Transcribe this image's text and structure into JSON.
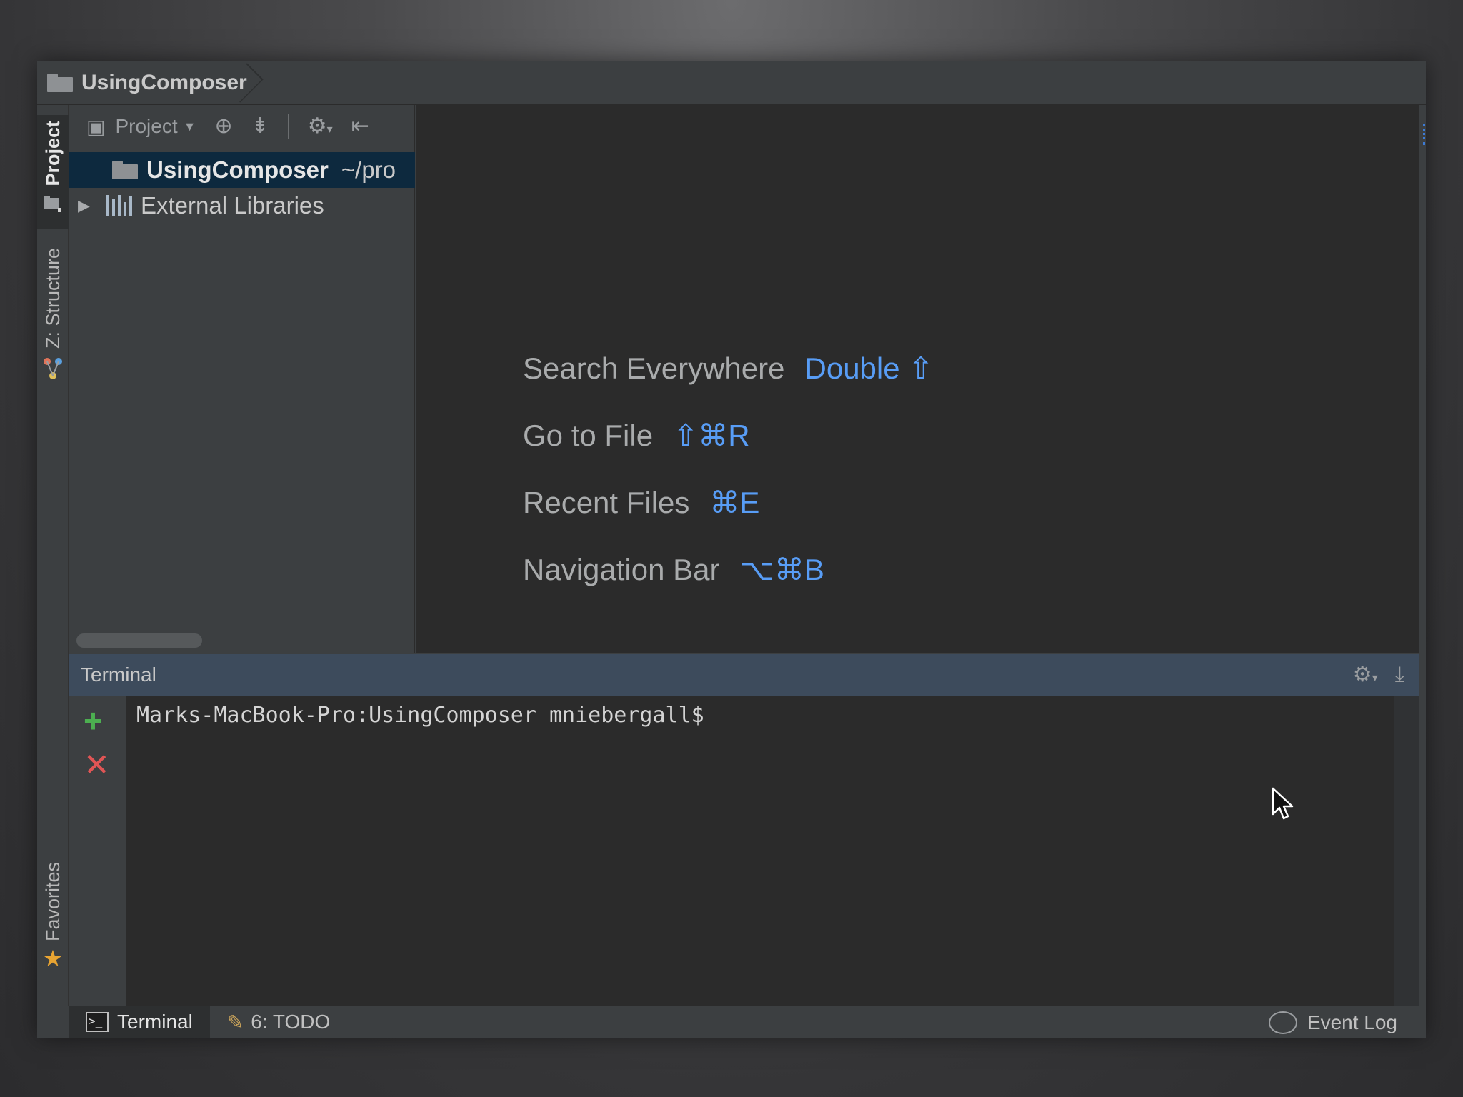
{
  "navbar": {
    "breadcrumb": "UsingComposer"
  },
  "left_stripe": {
    "project": "1: Project",
    "project_visible": "Project",
    "structure": "Z: Structure",
    "favorites": "Favorites"
  },
  "project_panel": {
    "dropdown_label": "Project",
    "tree": [
      {
        "label": "UsingComposer",
        "hint": "~/pro",
        "selected": true
      },
      {
        "label": "External Libraries",
        "collapsed": true
      }
    ]
  },
  "editor": {
    "hints": [
      {
        "label": "Search Everywhere",
        "shortcut": "Double ⇧"
      },
      {
        "label": "Go to File",
        "shortcut": "⇧⌘R"
      },
      {
        "label": "Recent Files",
        "shortcut": "⌘E"
      },
      {
        "label": "Navigation Bar",
        "shortcut": "⌥⌘B"
      }
    ]
  },
  "terminal": {
    "title": "Terminal",
    "prompt": "Marks-MacBook-Pro:UsingComposer mniebergall$"
  },
  "bottom_bar": {
    "terminal_tab": "Terminal",
    "todo_tab": "6: TODO",
    "event_log": "Event Log"
  },
  "colors": {
    "accent": "#589df6",
    "selection": "#0d293e",
    "terminal_header": "#3d4b5c",
    "editor_bg": "#2b2b2b",
    "add_green": "#4caf50",
    "close_red": "#e05555"
  }
}
